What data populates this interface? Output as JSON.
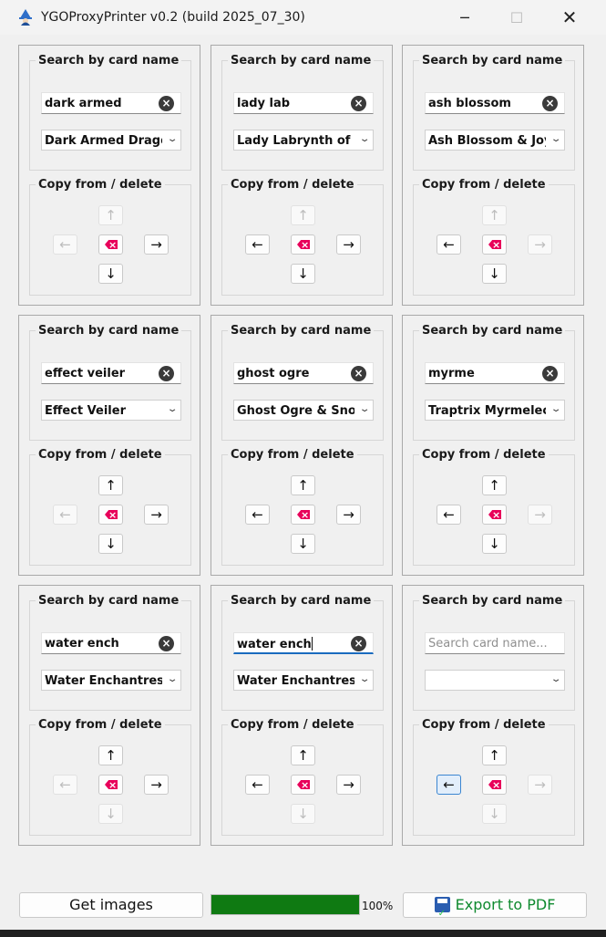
{
  "window": {
    "title": "YGOProxyPrinter v0.2 (build 2025_07_30)",
    "minimize": "─",
    "maximize": "☐",
    "close": "✕"
  },
  "labels": {
    "search_group": "Search by card name",
    "copy_group": "Copy from / delete",
    "arrow_up": "↑",
    "arrow_down": "↓",
    "arrow_left": "←",
    "arrow_right": "→",
    "clear": "×",
    "chevron": "⌄"
  },
  "slots": [
    {
      "query": "dark armed",
      "placeholder": "Search card name...",
      "selected": "Dark Armed Dragon",
      "focused": false,
      "up_enabled": false,
      "down_enabled": true,
      "left_enabled": false,
      "right_enabled": true,
      "left_hover": false
    },
    {
      "query": "lady lab",
      "placeholder": "Search card name...",
      "selected": "Lady Labrynth of the Silver Castle",
      "focused": false,
      "up_enabled": false,
      "down_enabled": true,
      "left_enabled": true,
      "right_enabled": true,
      "left_hover": false
    },
    {
      "query": "ash blossom",
      "placeholder": "Search card name...",
      "selected": "Ash Blossom & Joyous Spring",
      "focused": false,
      "up_enabled": false,
      "down_enabled": true,
      "left_enabled": true,
      "right_enabled": false,
      "left_hover": false
    },
    {
      "query": "effect veiler",
      "placeholder": "Search card name...",
      "selected": "Effect Veiler",
      "focused": false,
      "up_enabled": true,
      "down_enabled": true,
      "left_enabled": false,
      "right_enabled": true,
      "left_hover": false
    },
    {
      "query": "ghost ogre",
      "placeholder": "Search card name...",
      "selected": "Ghost Ogre & Snow Rabbit",
      "focused": false,
      "up_enabled": true,
      "down_enabled": true,
      "left_enabled": true,
      "right_enabled": true,
      "left_hover": false
    },
    {
      "query": "myrme",
      "placeholder": "Search card name...",
      "selected": "Traptrix Myrmeleo",
      "focused": false,
      "up_enabled": true,
      "down_enabled": true,
      "left_enabled": true,
      "right_enabled": false,
      "left_hover": false
    },
    {
      "query": "water ench",
      "placeholder": "Search card name...",
      "selected": "Water Enchantress",
      "focused": false,
      "up_enabled": true,
      "down_enabled": false,
      "left_enabled": false,
      "right_enabled": true,
      "left_hover": false
    },
    {
      "query": "water ench",
      "placeholder": "Search card name...",
      "selected": "Water Enchantress",
      "focused": true,
      "up_enabled": true,
      "down_enabled": false,
      "left_enabled": true,
      "right_enabled": true,
      "left_hover": false
    },
    {
      "query": "",
      "placeholder": "Search card name...",
      "selected": "",
      "focused": false,
      "up_enabled": true,
      "down_enabled": false,
      "left_enabled": true,
      "right_enabled": false,
      "left_hover": true
    }
  ],
  "footer": {
    "get_images": "Get images",
    "export_pdf": "Export to PDF",
    "progress_text": "100%",
    "progress_fraction": 1.0,
    "progress_color": "#0f7a12",
    "export_color": "#0f8a2f",
    "delete_icon_color": "#e8005a"
  },
  "icons": {
    "app": "wizard-app-icon",
    "delete": "backspace-delete-icon",
    "clear": "clear-x-icon",
    "export": "save-pdf-icon"
  }
}
